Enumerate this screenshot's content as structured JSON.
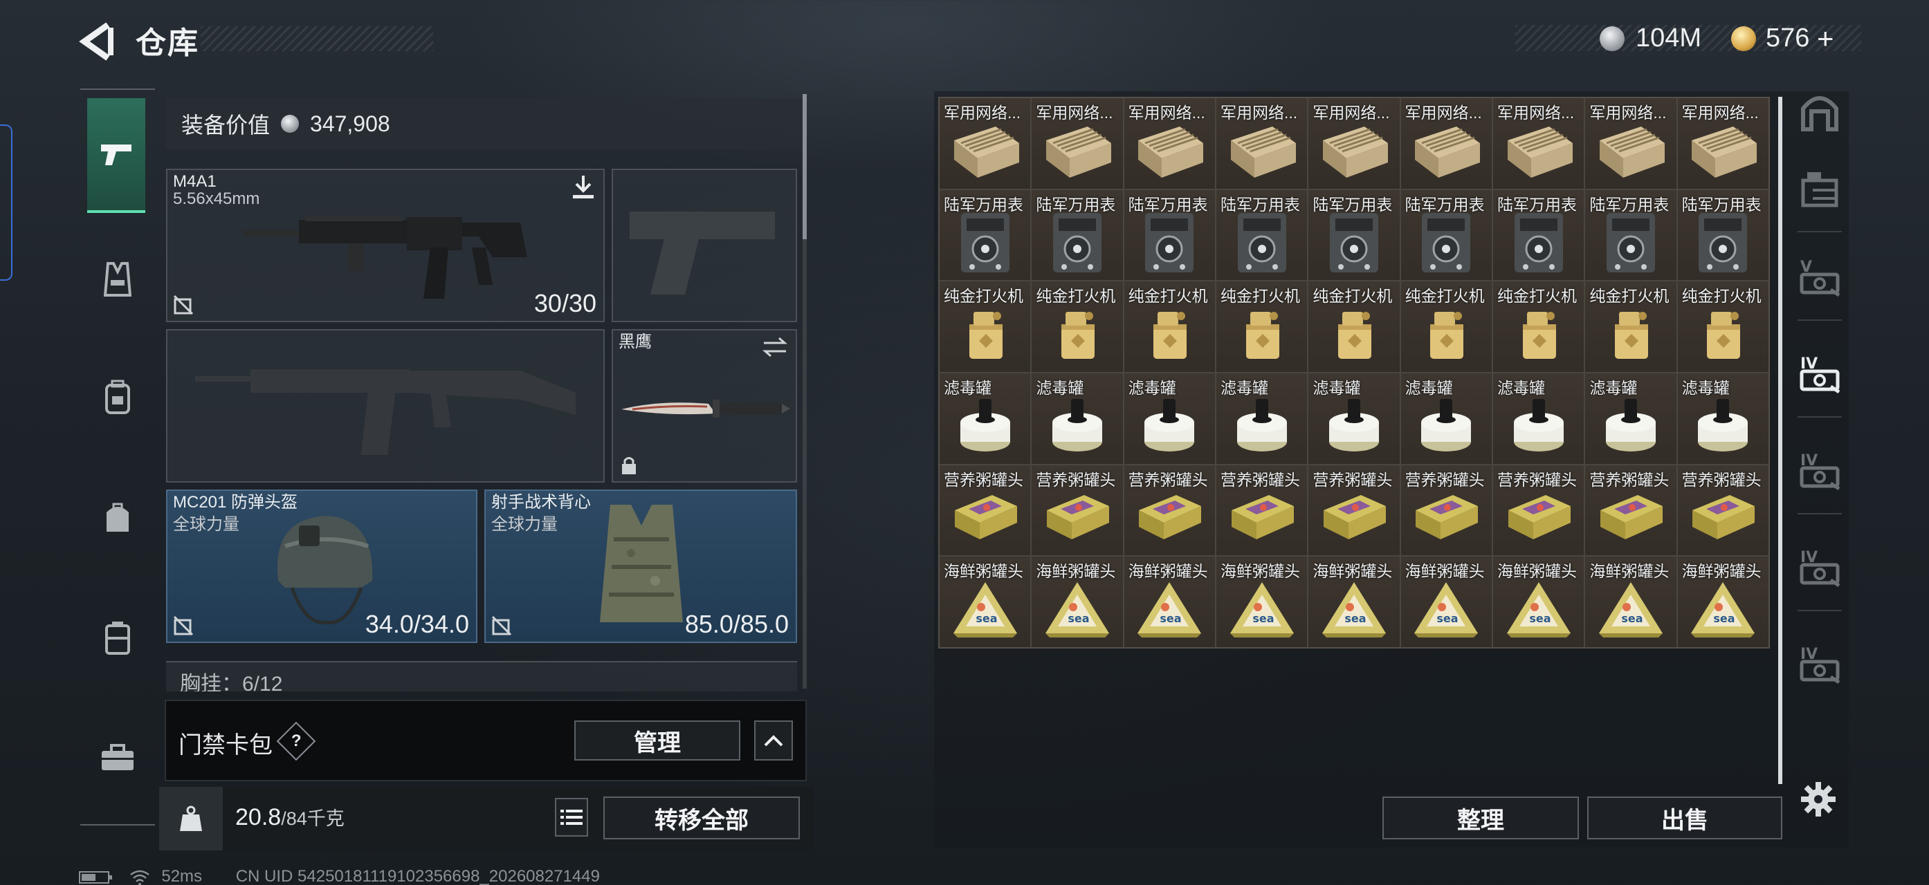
{
  "header": {
    "title": "仓库",
    "currency_silver": "104M",
    "currency_gold": "576",
    "currency_gold_plus": "+"
  },
  "left_nav": {
    "items": [
      {
        "icon": "pistol-icon",
        "active": true
      },
      {
        "icon": "vest-icon"
      },
      {
        "icon": "backpack-icon"
      },
      {
        "icon": "pouch-icon"
      },
      {
        "icon": "case-icon"
      },
      {
        "icon": "briefcase-icon"
      }
    ]
  },
  "equipment": {
    "value_label": "装备价值",
    "value": "347,908",
    "primary_weapon": {
      "name": "M4A1",
      "caliber": "5.56x45mm",
      "ammo": "30/30"
    },
    "melee": {
      "name": "黑鹰"
    },
    "helmet": {
      "name": "MC201 防弹头盔",
      "faction": "全球力量",
      "durability": "34.0/34.0"
    },
    "armor": {
      "name": "射手战术背心",
      "faction": "全球力量",
      "durability": "85.0/85.0"
    },
    "chest_rig_partial": "胸挂：6/12"
  },
  "keycard": {
    "label": "门禁卡包",
    "help": "?",
    "manage_button": "管理"
  },
  "bottom_bar": {
    "weight_current": "20.8",
    "weight_max": "/84千克",
    "transfer_all_button": "转移全部"
  },
  "storage": {
    "rows": [
      {
        "name": "军用网络...",
        "icon": "network-crate-icon"
      },
      {
        "name": "陆军万用表",
        "icon": "multimeter-icon"
      },
      {
        "name": "纯金打火机",
        "icon": "gold-lighter-icon"
      },
      {
        "name": "滤毒罐",
        "icon": "filter-canister-icon"
      },
      {
        "name": "营养粥罐头",
        "icon": "porridge-can-icon"
      },
      {
        "name": "海鲜粥罐头",
        "icon": "seafood-can-icon"
      }
    ],
    "columns": 9,
    "seafood_label": "sea",
    "sort_button": "整理",
    "sell_button": "出售"
  },
  "right_tabs": [
    {
      "icon": "arch-icon"
    },
    {
      "icon": "shelf-icon"
    },
    {
      "icon": "lv5-crate-icon",
      "level": "V"
    },
    {
      "icon": "lv4-crate-icon-active",
      "level": "IV"
    },
    {
      "icon": "lv4-crate-icon",
      "level": "IV"
    },
    {
      "icon": "lv4-crate-icon",
      "level": "IV"
    },
    {
      "icon": "lv4-crate-icon",
      "level": "IV"
    }
  ],
  "status_bar": {
    "ping": "52ms",
    "uid": "CN UID 54250181119102356698_202608271449"
  },
  "colors": {
    "accent_green": "#5fe0b0",
    "slot_blue": "#2e4a64",
    "cell_brown": "#3e3730"
  }
}
